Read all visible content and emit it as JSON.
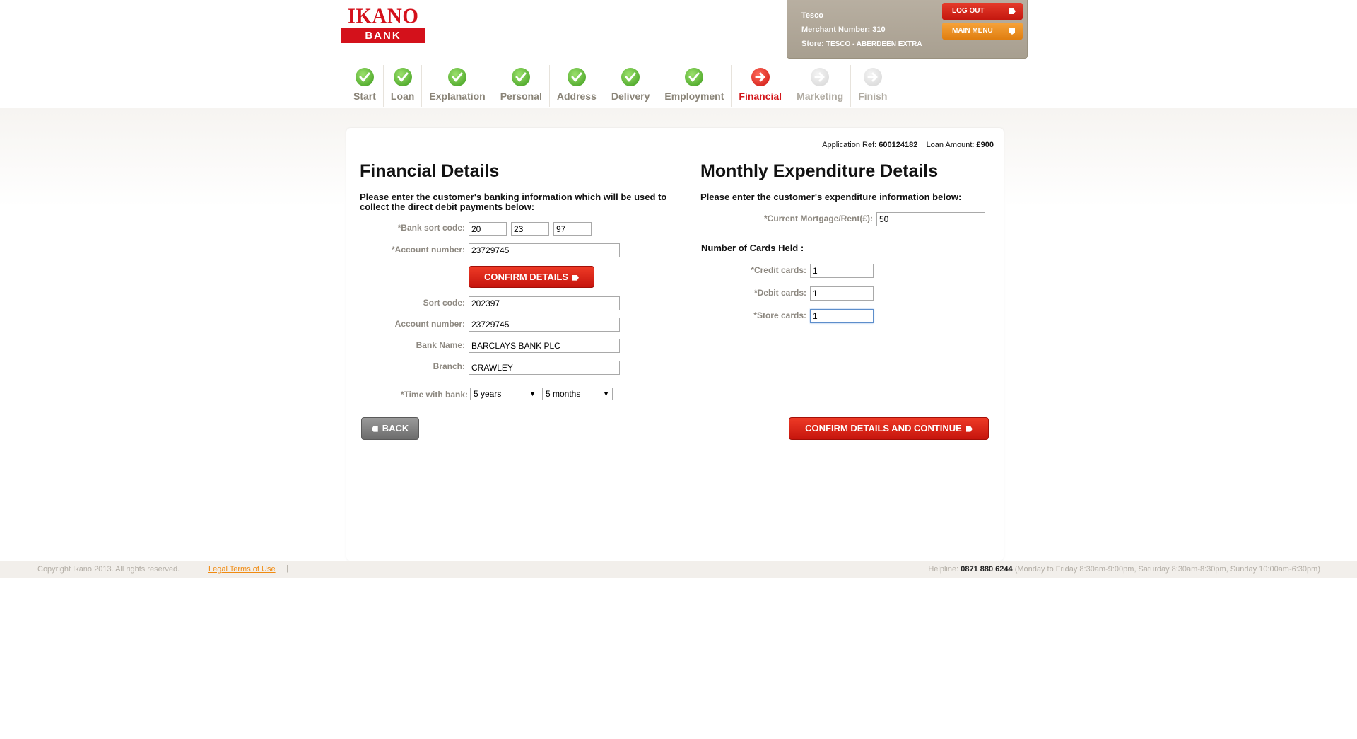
{
  "brand": {
    "logo_top": "IKANO",
    "logo_bottom": "BANK"
  },
  "merchant": {
    "name": "Tesco",
    "merchant_number_label": "Merchant Number:",
    "merchant_number": "310",
    "store_label": "Store:",
    "store": "TESCO - ABERDEEN EXTRA",
    "logout_label": "LOG OUT",
    "main_menu_label": "MAIN MENU"
  },
  "steps": [
    {
      "label": "Start",
      "state": "done"
    },
    {
      "label": "Loan",
      "state": "done"
    },
    {
      "label": "Explanation",
      "state": "done"
    },
    {
      "label": "Personal",
      "state": "done"
    },
    {
      "label": "Address",
      "state": "done"
    },
    {
      "label": "Delivery",
      "state": "done"
    },
    {
      "label": "Employment",
      "state": "done"
    },
    {
      "label": "Financial",
      "state": "current"
    },
    {
      "label": "Marketing",
      "state": "todo"
    },
    {
      "label": "Finish",
      "state": "todo"
    }
  ],
  "reference": {
    "app_ref_label": "Application Ref:",
    "app_ref": "600124182",
    "loan_amount_label": "Loan Amount:",
    "loan_amount": "£900"
  },
  "financial": {
    "title": "Financial Details",
    "intro": "Please enter the customer's banking information which will be used to collect the direct debit payments below:",
    "sort_code_label": "*Bank sort code:",
    "sort_code": [
      "20",
      "23",
      "97"
    ],
    "account_number_label": "*Account number:",
    "account_number": "23729745",
    "confirm_label": "CONFIRM DETAILS",
    "result_sort_code_label": "Sort code:",
    "result_sort_code": "202397",
    "result_account_label": "Account number:",
    "result_account": "23729745",
    "bank_name_label": "Bank Name:",
    "bank_name": "BARCLAYS BANK PLC",
    "branch_label": "Branch:",
    "branch": "CRAWLEY",
    "time_with_bank_label": "*Time with bank:",
    "time_years": "5 years",
    "time_months": "5 months"
  },
  "expenditure": {
    "title": "Monthly Expenditure Details",
    "intro": "Please enter the customer's expenditure information below:",
    "mortgage_label": "*Current Mortgage/Rent(£):",
    "mortgage": "50",
    "cards_heading": "Number of Cards Held :",
    "credit_label": "*Credit cards:",
    "credit": "1",
    "debit_label": "*Debit cards:",
    "debit": "1",
    "store_label": "*Store cards:",
    "store": "1"
  },
  "actions": {
    "back_label": "BACK",
    "continue_label": "CONFIRM DETAILS AND CONTINUE"
  },
  "footer": {
    "copyright": "Copyright Ikano 2013. All rights reserved.",
    "legal": "Legal Terms of Use",
    "pipe": "|",
    "helpline_label": "Helpline:",
    "helpline": "0871 880 6244",
    "hours": "(Monday to Friday 8:30am-9:00pm, Saturday 8:30am-8:30pm, Sunday 10:00am-6:30pm)"
  },
  "colors": {
    "brand_red": "#d4111b",
    "accent_orange": "#f08a10",
    "panel_taupe": "#b0a797",
    "done_green": "#3c9b1b"
  },
  "icons": {
    "done": "check-icon",
    "current": "arrow-right-icon",
    "todo": "arrow-right-icon"
  }
}
